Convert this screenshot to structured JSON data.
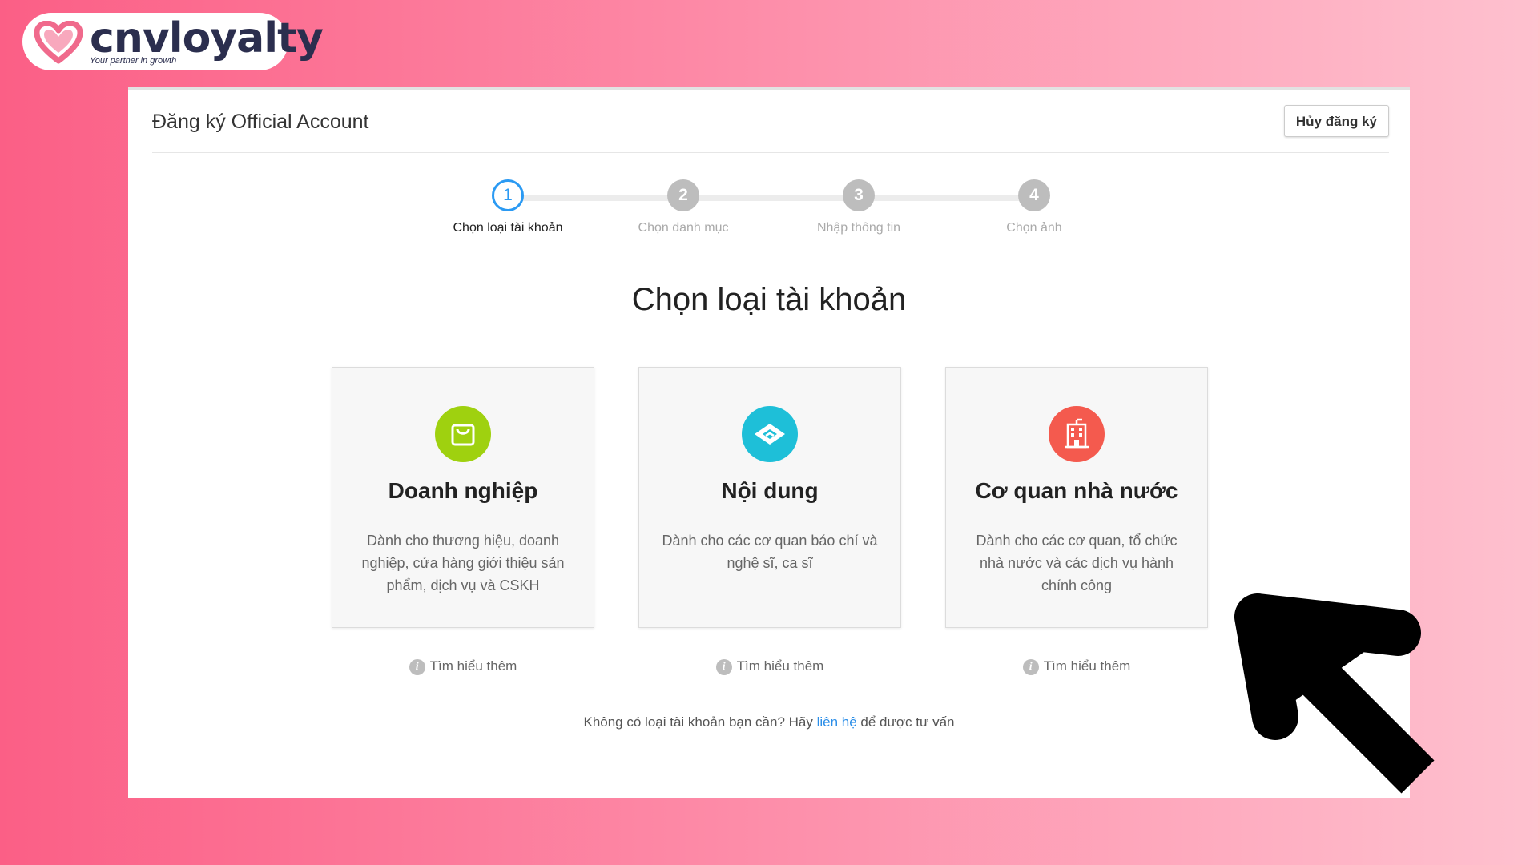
{
  "logo": {
    "brand": "cnvloyalty",
    "tagline": "Your partner in growth"
  },
  "header": {
    "title": "Đăng ký Official Account",
    "cancel_label": "Hủy đăng ký"
  },
  "stepper": {
    "steps": [
      {
        "number": "1",
        "label": "Chọn loại tài khoản",
        "state": "active"
      },
      {
        "number": "2",
        "label": "Chọn danh mục",
        "state": "inactive"
      },
      {
        "number": "3",
        "label": "Nhập thông tin",
        "state": "inactive"
      },
      {
        "number": "4",
        "label": "Chọn ảnh",
        "state": "inactive"
      }
    ]
  },
  "main": {
    "title": "Chọn loại tài khoản",
    "cards": [
      {
        "title": "Doanh nghiệp",
        "description": "Dành cho thương hiệu, doanh nghiệp, cửa hàng giới thiệu sản phẩm, dịch vụ và CSKH",
        "icon": "shopping-bag-icon",
        "color": "#9fd10f",
        "learn_more": "Tìm hiểu thêm"
      },
      {
        "title": "Nội dung",
        "description": "Dành cho các cơ quan báo chí và nghệ sĩ, ca sĩ",
        "icon": "content-icon",
        "color": "#1ebfd8",
        "learn_more": "Tìm hiểu thêm"
      },
      {
        "title": "Cơ quan nhà nước",
        "description": "Dành cho các cơ quan, tổ chức nhà nước và các dịch vụ hành chính công",
        "icon": "building-icon",
        "color": "#f45a4e",
        "learn_more": "Tìm hiểu thêm"
      }
    ],
    "footer": {
      "before": "Không có loại tài khoản bạn cần? Hãy ",
      "link": "liên hệ",
      "after": " để được tư vấn"
    }
  },
  "colors": {
    "accent": "#2b9af3",
    "link": "#2b8ee8"
  }
}
